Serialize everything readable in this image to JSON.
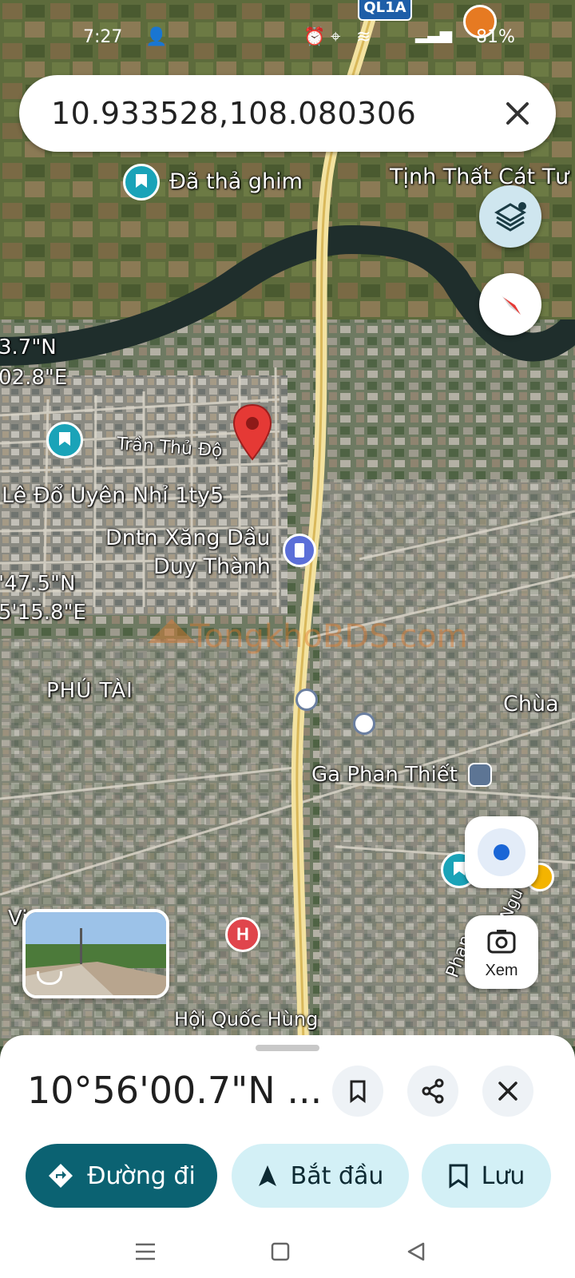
{
  "status_bar": {
    "time": "7:27",
    "battery": "81%"
  },
  "search": {
    "query": "10.933528,108.080306"
  },
  "map": {
    "road_shield": "QL1A",
    "labels": {
      "dropped_pin": "Đã thả ghim",
      "tinh_that": "Tịnh Thất Cát Tư",
      "tran_thu_do": "Trần Thủ Độ",
      "le_do": "Lê Đổ Uyên Nhỉ 1ty5",
      "xang_dau_1": "Dntn Xăng Dầu",
      "xang_dau_2": "Duy Thành",
      "phu_tai": "PHÚ TÀI",
      "chua": "Chùa",
      "ga_phan_thiet": "Ga Phan Thiết",
      "coord_frag_1": "3.7\"N",
      "coord_frag_2": "02.8\"E",
      "coord_frag_3": "'47.5\"N",
      "coord_frag_4": "5'15.8\"E",
      "vi_frag": "Vi",
      "phan_frag": "Phan",
      "nguy_frag": "Ngu",
      "bottom_frag": "Hội Quốc Hùng"
    },
    "watermark": "TongkhoBDS",
    "watermark_suffix": ".com",
    "explore_label": "Xem"
  },
  "sheet": {
    "coordinates": "10°56'00.7\"N ...",
    "buttons": {
      "directions": "Đường đi",
      "start": "Bắt đầu",
      "save": "Lưu"
    }
  },
  "colors": {
    "accent": "#0b6272",
    "pill_bg": "#d3f0f6",
    "pin": "#e53935",
    "teal": "#1aa3b8"
  }
}
